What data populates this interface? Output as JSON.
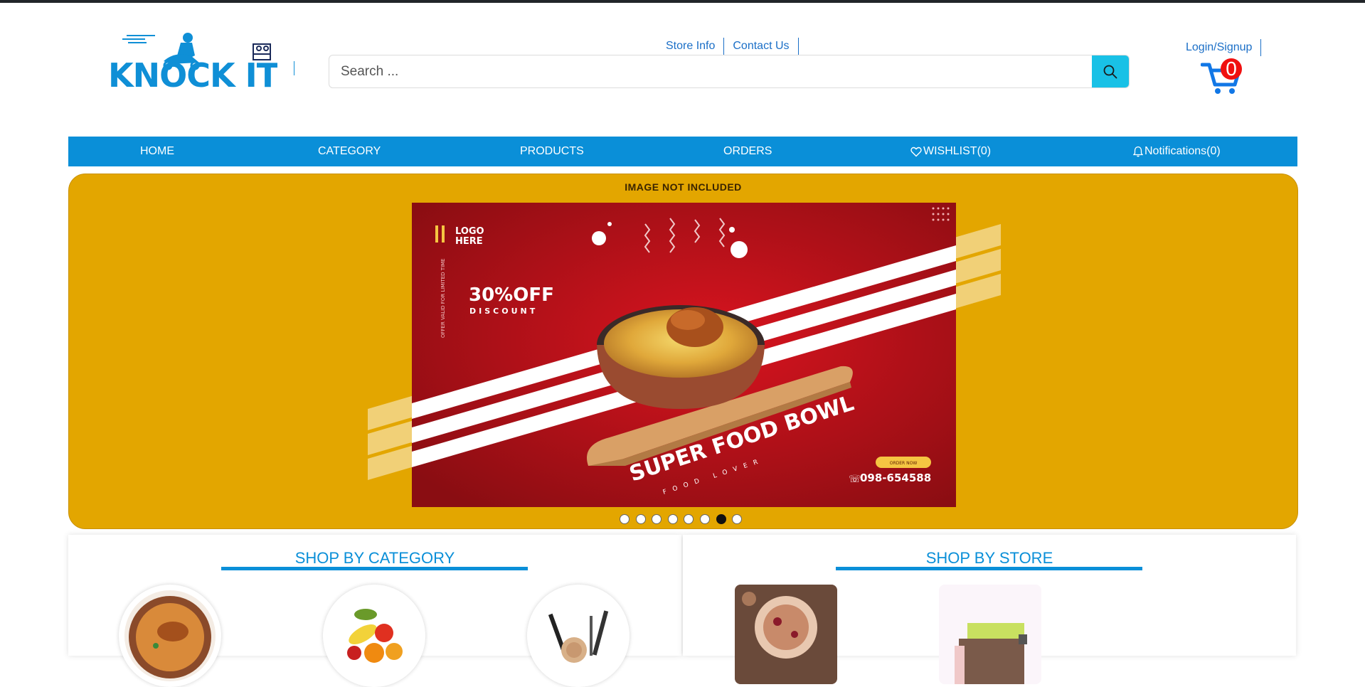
{
  "header": {
    "logo_text": "KNOCK IT",
    "top_links": [
      "Store Info",
      "Contact Us"
    ],
    "search_placeholder": "Search ...",
    "login_label": "Login/Signup",
    "cart_count": "0"
  },
  "nav": {
    "home": "HOME",
    "category": "CATEGORY",
    "products": "PRODUCTS",
    "orders": "ORDERS",
    "wishlist": "WISHLIST(0)",
    "notifications": "Notifications(0)"
  },
  "banner": {
    "note": "IMAGE NOT INCLUDED",
    "logo_line1": "LOGO",
    "logo_line2": "HERE",
    "side_text": "OFFER VALID FOR LIMITED TIME",
    "discount": "30%OFF",
    "discount_sub": "DISCOUNT",
    "headline": "SUPER FOOD BOWL",
    "tagline": "FOOD LOVER",
    "order_btn": "ORDER NOW",
    "phone": "098-654588",
    "slide_count": 8,
    "active_slide": 6
  },
  "sections": {
    "category_title": "SHOP BY CATEGORY",
    "store_title": "SHOP BY STORE"
  },
  "colors": {
    "brand_blue": "#0a8fd8",
    "banner_bg": "#e3a600",
    "search_btn": "#19c1e6",
    "badge": "#f01010"
  }
}
